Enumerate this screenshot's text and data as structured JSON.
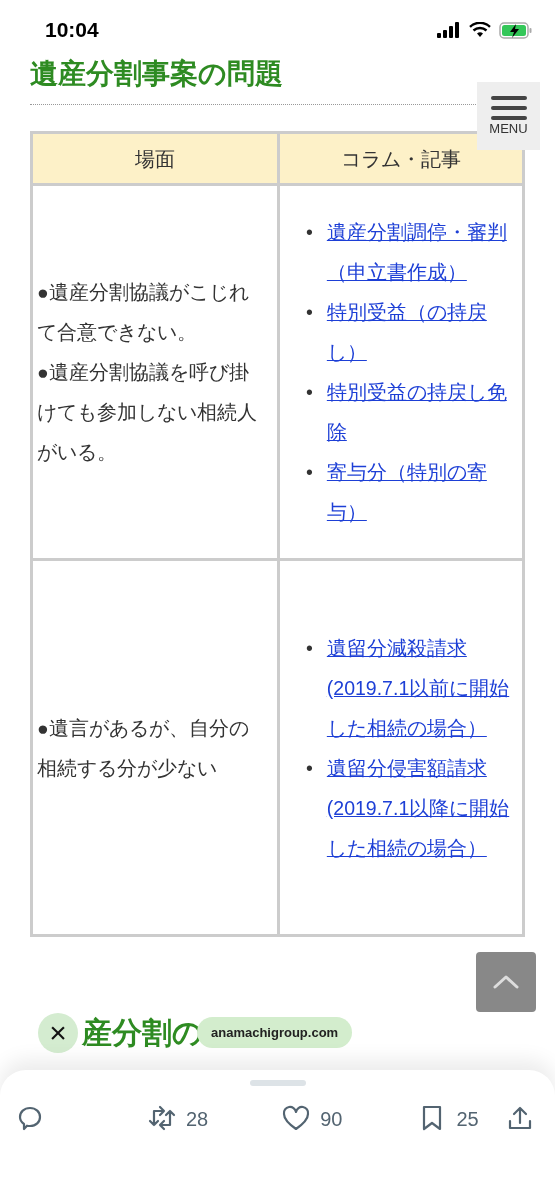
{
  "status_bar": {
    "time": "10:04"
  },
  "heading": "遺産分割事案の問題",
  "menu_button": {
    "label": "MENU"
  },
  "table": {
    "columns": [
      "場面",
      "コラム・記事"
    ],
    "rows": [
      {
        "scene": [
          "●遺産分割協議がこじれて合意できない。",
          "●遺産分割協議を呼び掛けても参加しない相続人がいる。"
        ],
        "links": [
          {
            "marker": "•",
            "text": "遺産分割調停・審判（申立書作成）"
          },
          {
            "marker": "•",
            "text": "特別受益（の持戻し）"
          },
          {
            "marker": "•",
            "text": "特別受益の持戻し免除"
          },
          {
            "marker": "•",
            "text": "寄与分（特別の寄与）"
          }
        ]
      },
      {
        "scene": [
          "●遺言があるが、自分の相続する分が少ない"
        ],
        "links": [
          {
            "marker": "•",
            "text": "遺留分減殺請求(2019.7.1以前に開始した相続の場合）"
          },
          {
            "marker": "•",
            "text": "遺留分侵害額請求(2019.7.1以降に開始した相続の場合）"
          }
        ]
      }
    ]
  },
  "next_heading": "産分割の",
  "link_preview": {
    "close": "×",
    "domain": "anamachigroup.com"
  },
  "actions": [
    {
      "kind": "reply"
    },
    {
      "kind": "repost",
      "count": "28"
    },
    {
      "kind": "like",
      "count": "90"
    },
    {
      "kind": "bookmark",
      "count": "25"
    },
    {
      "kind": "share"
    }
  ]
}
